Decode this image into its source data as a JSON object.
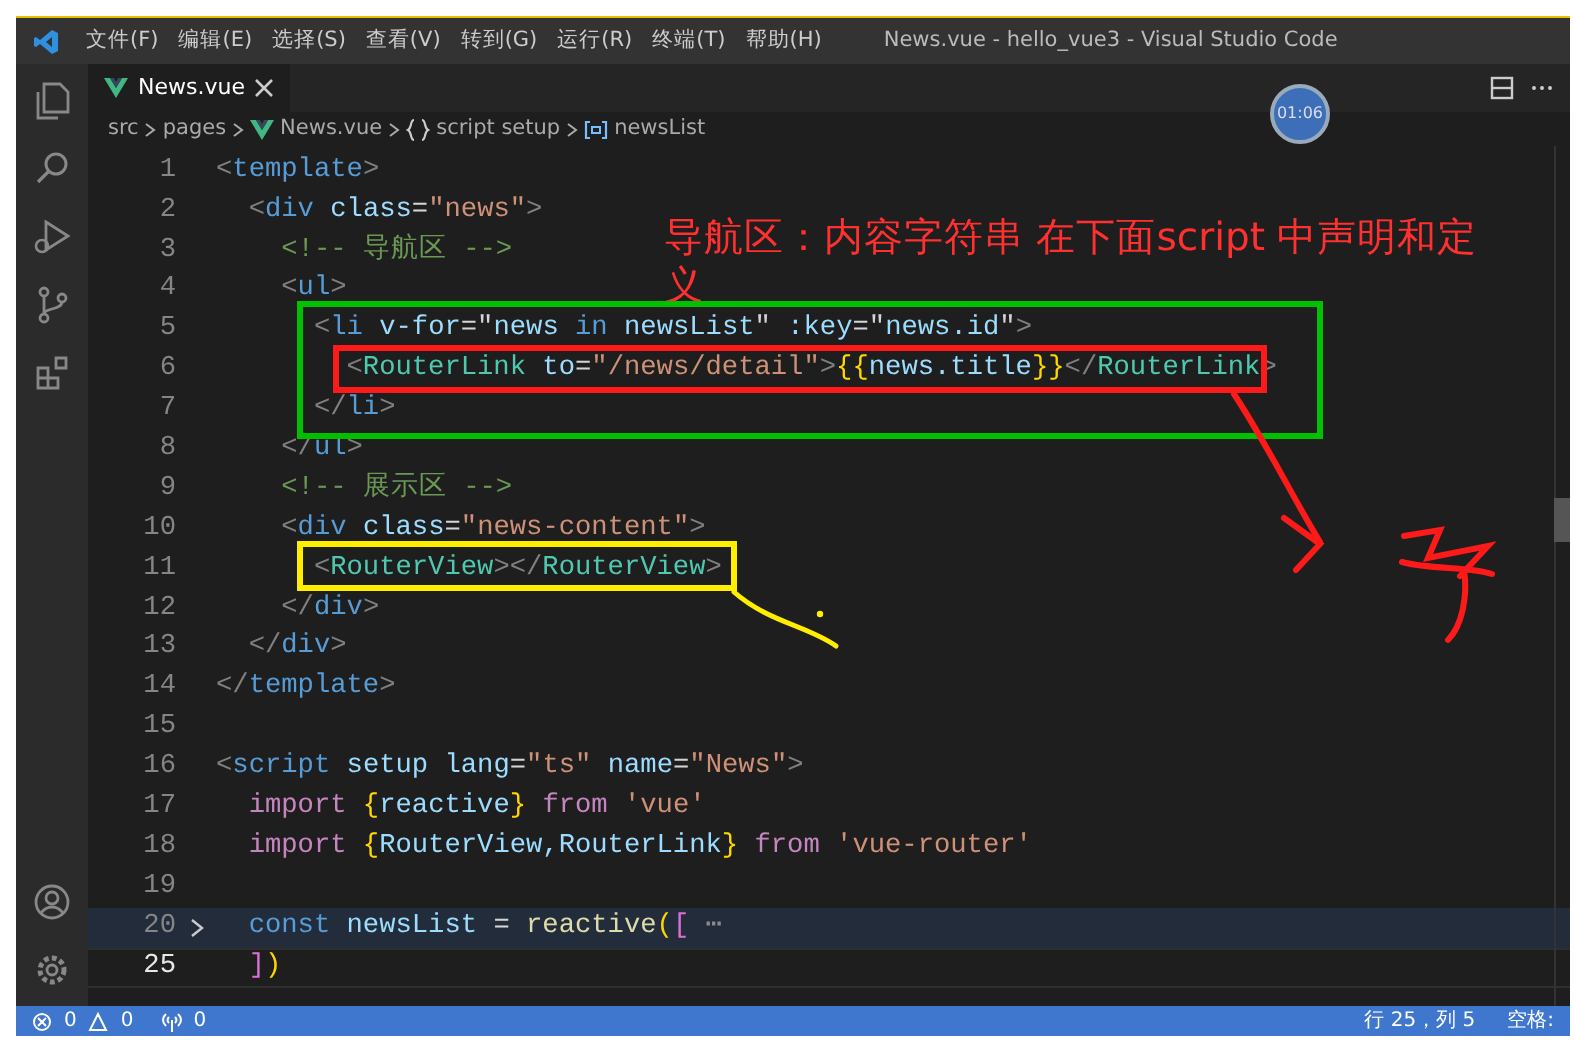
{
  "window": {
    "title": "News.vue - hello_vue3 - Visual Studio Code"
  },
  "menu": [
    "文件(F)",
    "编辑(E)",
    "选择(S)",
    "查看(V)",
    "转到(G)",
    "运行(R)",
    "终端(T)",
    "帮助(H)"
  ],
  "activity_bar": [
    {
      "kind": "files",
      "selected": false
    },
    {
      "kind": "search",
      "selected": false
    },
    {
      "kind": "debug",
      "selected": false
    },
    {
      "kind": "git",
      "selected": false
    },
    {
      "kind": "extensions",
      "selected": false
    }
  ],
  "tabs": [
    {
      "label": "News.vue",
      "selected": true
    }
  ],
  "recorder_timer": "01:06",
  "breadcrumbs": [
    {
      "kind": "folder",
      "label": "src"
    },
    {
      "kind": "folder",
      "label": "pages"
    },
    {
      "kind": "vue",
      "label": "News.vue"
    },
    {
      "kind": "braces",
      "label": "script setup"
    },
    {
      "kind": "variable",
      "label": "newsList"
    }
  ],
  "code": {
    "lines": [
      {
        "number": "1",
        "folded": false,
        "current": false,
        "tokens": [
          {
            "kind": "p",
            "text": "<"
          },
          {
            "kind": "t",
            "text": "template"
          },
          {
            "kind": "p",
            "text": ">"
          }
        ]
      },
      {
        "number": "2",
        "folded": false,
        "current": false,
        "tokens": [
          {
            "kind": "p",
            "text": "  <"
          },
          {
            "kind": "t",
            "text": "div"
          },
          {
            "kind": "a",
            "text": " class"
          },
          {
            "kind": "w",
            "text": "="
          },
          {
            "kind": "s",
            "text": "\"news\""
          },
          {
            "kind": "p",
            "text": ">"
          }
        ]
      },
      {
        "number": "3",
        "folded": false,
        "current": false,
        "tokens": [
          {
            "kind": "m",
            "text": "    <!-- 导航区 -->"
          }
        ]
      },
      {
        "number": "4",
        "folded": false,
        "current": false,
        "tokens": [
          {
            "kind": "p",
            "text": "    <"
          },
          {
            "kind": "t",
            "text": "ul"
          },
          {
            "kind": "p",
            "text": ">"
          }
        ]
      },
      {
        "number": "5",
        "folded": false,
        "current": false,
        "tokens": [
          {
            "kind": "p",
            "text": "      <"
          },
          {
            "kind": "t",
            "text": "li"
          },
          {
            "kind": "a",
            "text": " v-for"
          },
          {
            "kind": "w",
            "text": "=\""
          },
          {
            "kind": "v",
            "text": "news"
          },
          {
            "kind": "d",
            "text": " in "
          },
          {
            "kind": "v",
            "text": "newsList"
          },
          {
            "kind": "w",
            "text": "\""
          },
          {
            "kind": "a",
            "text": " :key"
          },
          {
            "kind": "w",
            "text": "=\""
          },
          {
            "kind": "v",
            "text": "news.id"
          },
          {
            "kind": "w",
            "text": "\""
          },
          {
            "kind": "p",
            "text": ">"
          }
        ]
      },
      {
        "number": "6",
        "folded": false,
        "current": false,
        "tokens": [
          {
            "kind": "p",
            "text": "        <"
          },
          {
            "kind": "c",
            "text": "RouterLink"
          },
          {
            "kind": "a",
            "text": " to"
          },
          {
            "kind": "w",
            "text": "="
          },
          {
            "kind": "s",
            "text": "\"/news/detail\""
          },
          {
            "kind": "p",
            "text": ">"
          },
          {
            "kind": "b",
            "text": "{{"
          },
          {
            "kind": "v",
            "text": "news.title"
          },
          {
            "kind": "b",
            "text": "}}"
          },
          {
            "kind": "p",
            "text": "</"
          },
          {
            "kind": "c",
            "text": "RouterLink"
          },
          {
            "kind": "p",
            "text": ">"
          }
        ]
      },
      {
        "number": "7",
        "folded": false,
        "current": false,
        "tokens": [
          {
            "kind": "p",
            "text": "      </"
          },
          {
            "kind": "t",
            "text": "li"
          },
          {
            "kind": "p",
            "text": ">"
          }
        ]
      },
      {
        "number": "8",
        "folded": false,
        "current": false,
        "tokens": [
          {
            "kind": "p",
            "text": "    </"
          },
          {
            "kind": "t",
            "text": "ul"
          },
          {
            "kind": "p",
            "text": ">"
          }
        ]
      },
      {
        "number": "9",
        "folded": false,
        "current": false,
        "tokens": [
          {
            "kind": "m",
            "text": "    <!-- 展示区 -->"
          }
        ]
      },
      {
        "number": "10",
        "folded": false,
        "current": false,
        "tokens": [
          {
            "kind": "p",
            "text": "    <"
          },
          {
            "kind": "t",
            "text": "div"
          },
          {
            "kind": "a",
            "text": " class"
          },
          {
            "kind": "w",
            "text": "="
          },
          {
            "kind": "s",
            "text": "\"news-content\""
          },
          {
            "kind": "p",
            "text": ">"
          }
        ]
      },
      {
        "number": "11",
        "folded": false,
        "current": false,
        "tokens": [
          {
            "kind": "p",
            "text": "      <"
          },
          {
            "kind": "c",
            "text": "RouterView"
          },
          {
            "kind": "p",
            "text": "></"
          },
          {
            "kind": "c",
            "text": "RouterView"
          },
          {
            "kind": "p",
            "text": ">"
          }
        ]
      },
      {
        "number": "12",
        "folded": false,
        "current": false,
        "tokens": [
          {
            "kind": "p",
            "text": "    </"
          },
          {
            "kind": "t",
            "text": "div"
          },
          {
            "kind": "p",
            "text": ">"
          }
        ]
      },
      {
        "number": "13",
        "folded": false,
        "current": false,
        "tokens": [
          {
            "kind": "p",
            "text": "  </"
          },
          {
            "kind": "t",
            "text": "div"
          },
          {
            "kind": "p",
            "text": ">"
          }
        ]
      },
      {
        "number": "14",
        "folded": false,
        "current": false,
        "tokens": [
          {
            "kind": "p",
            "text": "</"
          },
          {
            "kind": "t",
            "text": "template"
          },
          {
            "kind": "p",
            "text": ">"
          }
        ]
      },
      {
        "number": "15",
        "folded": false,
        "current": false
      },
      {
        "number": "16",
        "folded": false,
        "current": false,
        "tokens": [
          {
            "kind": "p",
            "text": "<"
          },
          {
            "kind": "t",
            "text": "script"
          },
          {
            "kind": "a",
            "text": " setup"
          },
          {
            "kind": "a",
            "text": " lang"
          },
          {
            "kind": "w",
            "text": "="
          },
          {
            "kind": "s",
            "text": "\"ts\""
          },
          {
            "kind": "a",
            "text": " name"
          },
          {
            "kind": "w",
            "text": "="
          },
          {
            "kind": "s",
            "text": "\"News\""
          },
          {
            "kind": "p",
            "text": ">"
          }
        ]
      },
      {
        "number": "17",
        "folded": false,
        "current": false,
        "tokens": [
          {
            "kind": "k",
            "text": "  import"
          },
          {
            "kind": "b",
            "text": " {"
          },
          {
            "kind": "v",
            "text": "reactive"
          },
          {
            "kind": "b",
            "text": "}"
          },
          {
            "kind": "k",
            "text": " from"
          },
          {
            "kind": "s",
            "text": " 'vue'"
          }
        ]
      },
      {
        "number": "18",
        "folded": false,
        "current": false,
        "tokens": [
          {
            "kind": "k",
            "text": "  import"
          },
          {
            "kind": "b",
            "text": " {"
          },
          {
            "kind": "v",
            "text": "RouterView,RouterLink"
          },
          {
            "kind": "b",
            "text": "}"
          },
          {
            "kind": "k",
            "text": " from"
          },
          {
            "kind": "s",
            "text": " 'vue-router'"
          }
        ]
      },
      {
        "number": "19",
        "folded": false,
        "current": false
      },
      {
        "number": "20",
        "folded": true,
        "current": false,
        "tokens": [
          {
            "kind": "d",
            "text": "  const"
          },
          {
            "kind": "v",
            "text": " newsList"
          },
          {
            "kind": "w",
            "text": " = "
          },
          {
            "kind": "f",
            "text": "reactive"
          },
          {
            "kind": "b",
            "text": "("
          },
          {
            "kind": "q",
            "text": "["
          },
          {
            "kind": "e",
            "text": " ⋯"
          }
        ]
      },
      {
        "number": "25",
        "folded": false,
        "current": true,
        "tokens": [
          {
            "kind": "q",
            "text": "  ]"
          },
          {
            "kind": "b",
            "text": ")"
          }
        ]
      }
    ]
  },
  "annotation": {
    "lines": [
      "导航区：内容字符串 在下面script 中声明和定",
      "义"
    ],
    "frames": [
      {
        "color": "#00c000"
      },
      {
        "color": "#ff1a1a"
      },
      {
        "color": "#ffee00"
      }
    ]
  },
  "status_bar": {
    "errors": "0",
    "warnings": "0",
    "ports": "0",
    "position": "行 25，列 5",
    "indent": "空格:"
  }
}
